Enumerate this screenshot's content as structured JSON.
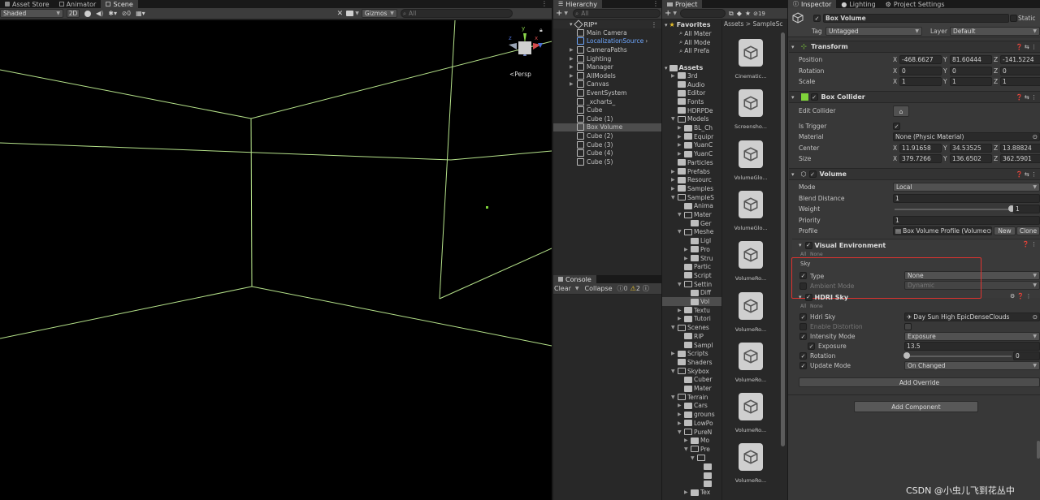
{
  "top_tabs": {
    "asset_store": "Asset Store",
    "animator": "Animator",
    "scene": "Scene",
    "hierarchy": "Hierarchy",
    "project": "Project",
    "inspector": "Inspector",
    "lighting": "Lighting",
    "project_settings": "Project Settings"
  },
  "scene_toolbar": {
    "shading": "Shaded",
    "mode_2d": "2D",
    "hidden_count": "0",
    "gizmos": "Gizmos",
    "search_placeholder": "All",
    "persp_label": "<Persp",
    "gizmo_y": "y",
    "gizmo_x": "x",
    "gizmo_z": "z"
  },
  "hierarchy": {
    "search_placeholder": "All",
    "root": "RIP*",
    "items": [
      {
        "label": "Main Camera",
        "selected": false,
        "arrow": false,
        "color": "#c4c4c4"
      },
      {
        "label": "LocalizationSource",
        "selected": false,
        "arrow": false,
        "color": "#6ea7ff"
      },
      {
        "label": "CameraPaths",
        "selected": false,
        "arrow": true,
        "color": "#c4c4c4"
      },
      {
        "label": "Lighting",
        "selected": false,
        "arrow": true,
        "color": "#c4c4c4"
      },
      {
        "label": "Manager",
        "selected": false,
        "arrow": true,
        "color": "#c4c4c4"
      },
      {
        "label": "AllModels",
        "selected": false,
        "arrow": true,
        "color": "#c4c4c4"
      },
      {
        "label": "Canvas",
        "selected": false,
        "arrow": true,
        "color": "#c4c4c4"
      },
      {
        "label": "EventSystem",
        "selected": false,
        "arrow": false,
        "color": "#c4c4c4"
      },
      {
        "label": "_xcharts_",
        "selected": false,
        "arrow": false,
        "color": "#c4c4c4"
      },
      {
        "label": "Cube",
        "selected": false,
        "arrow": false,
        "color": "#c4c4c4"
      },
      {
        "label": "Cube (1)",
        "selected": false,
        "arrow": false,
        "color": "#c4c4c4"
      },
      {
        "label": "Box Volume",
        "selected": true,
        "arrow": false,
        "color": "#c4c4c4"
      },
      {
        "label": "Cube (2)",
        "selected": false,
        "arrow": false,
        "color": "#c4c4c4"
      },
      {
        "label": "Cube (3)",
        "selected": false,
        "arrow": false,
        "color": "#c4c4c4"
      },
      {
        "label": "Cube (4)",
        "selected": false,
        "arrow": false,
        "color": "#c4c4c4"
      },
      {
        "label": "Cube (5)",
        "selected": false,
        "arrow": false,
        "color": "#c4c4c4"
      }
    ]
  },
  "console": {
    "tab": "Console",
    "clear": "Clear",
    "collapse": "Collapse",
    "info_count": "0",
    "warn_count": "2"
  },
  "project": {
    "hidden_count": "19",
    "breadcrumb": "Assets > SampleSc",
    "favorites": "Favorites",
    "fav_items": [
      "All Mater",
      "All Mode",
      "All Prefa"
    ],
    "assets_root": "Assets",
    "tree": [
      {
        "label": "3rd",
        "indent": 0,
        "arrow": "right"
      },
      {
        "label": "Audio",
        "indent": 0,
        "arrow": "none"
      },
      {
        "label": "Editor",
        "indent": 0,
        "arrow": "none"
      },
      {
        "label": "Fonts",
        "indent": 0,
        "arrow": "none"
      },
      {
        "label": "HDRPDe",
        "indent": 0,
        "arrow": "none"
      },
      {
        "label": "Models",
        "indent": 0,
        "arrow": "down"
      },
      {
        "label": "BL_Ch",
        "indent": 1,
        "arrow": "right"
      },
      {
        "label": "Equipr",
        "indent": 1,
        "arrow": "right"
      },
      {
        "label": "YuanC",
        "indent": 1,
        "arrow": "right"
      },
      {
        "label": "YuanC",
        "indent": 1,
        "arrow": "right"
      },
      {
        "label": "Particles",
        "indent": 0,
        "arrow": "none"
      },
      {
        "label": "Prefabs",
        "indent": 0,
        "arrow": "right"
      },
      {
        "label": "Resourc",
        "indent": 0,
        "arrow": "right"
      },
      {
        "label": "Samples",
        "indent": 0,
        "arrow": "right"
      },
      {
        "label": "SampleS",
        "indent": 0,
        "arrow": "down"
      },
      {
        "label": "Anima",
        "indent": 1,
        "arrow": "none"
      },
      {
        "label": "Mater",
        "indent": 1,
        "arrow": "down"
      },
      {
        "label": "Ger",
        "indent": 2,
        "arrow": "none"
      },
      {
        "label": "Meshe",
        "indent": 1,
        "arrow": "down"
      },
      {
        "label": "Ligl",
        "indent": 2,
        "arrow": "none"
      },
      {
        "label": "Pro",
        "indent": 2,
        "arrow": "right"
      },
      {
        "label": "Stru",
        "indent": 2,
        "arrow": "right"
      },
      {
        "label": "Partic",
        "indent": 1,
        "arrow": "none"
      },
      {
        "label": "Script",
        "indent": 1,
        "arrow": "none"
      },
      {
        "label": "Settin",
        "indent": 1,
        "arrow": "down"
      },
      {
        "label": "Diff",
        "indent": 2,
        "arrow": "none"
      },
      {
        "label": "Vol",
        "indent": 2,
        "arrow": "none",
        "selected": true
      },
      {
        "label": "Textu",
        "indent": 1,
        "arrow": "right"
      },
      {
        "label": "Tutori",
        "indent": 1,
        "arrow": "right"
      },
      {
        "label": "Scenes",
        "indent": 0,
        "arrow": "down"
      },
      {
        "label": "RIP",
        "indent": 1,
        "arrow": "none"
      },
      {
        "label": "Sampl",
        "indent": 1,
        "arrow": "none"
      },
      {
        "label": "Scripts",
        "indent": 0,
        "arrow": "right"
      },
      {
        "label": "Shaders",
        "indent": 0,
        "arrow": "none"
      },
      {
        "label": "Skybox",
        "indent": 0,
        "arrow": "down"
      },
      {
        "label": "Cuber",
        "indent": 1,
        "arrow": "none"
      },
      {
        "label": "Mater",
        "indent": 1,
        "arrow": "none"
      },
      {
        "label": "Terrain",
        "indent": 0,
        "arrow": "down"
      },
      {
        "label": "Cars",
        "indent": 1,
        "arrow": "right"
      },
      {
        "label": "grouns",
        "indent": 1,
        "arrow": "right"
      },
      {
        "label": "LowPo",
        "indent": 1,
        "arrow": "right"
      },
      {
        "label": "PureN",
        "indent": 1,
        "arrow": "down"
      },
      {
        "label": "Mo",
        "indent": 2,
        "arrow": "right"
      },
      {
        "label": "Pre",
        "indent": 2,
        "arrow": "down"
      },
      {
        "label": "",
        "indent": 3,
        "arrow": "down"
      },
      {
        "label": "",
        "indent": 4,
        "arrow": "none"
      },
      {
        "label": "",
        "indent": 4,
        "arrow": "none"
      },
      {
        "label": "",
        "indent": 4,
        "arrow": "none"
      },
      {
        "label": "Tex",
        "indent": 2,
        "arrow": "right"
      }
    ],
    "assets": [
      "Cinematic...",
      "Screensho...",
      "VolumeGlo...",
      "VolumeGlo...",
      "VolumeRo...",
      "VolumeRo...",
      "VolumeRo...",
      "VolumeRo...",
      "VolumeRo..."
    ]
  },
  "inspector": {
    "object_name": "Box Volume",
    "static_label": "Static",
    "tag_label": "Tag",
    "tag_value": "Untagged",
    "layer_label": "Layer",
    "layer_value": "Default",
    "transform": {
      "title": "Transform",
      "position_label": "Position",
      "rotation_label": "Rotation",
      "scale_label": "Scale",
      "position": [
        "-468.6627",
        "81.60444",
        "-141.5224"
      ],
      "rotation": [
        "0",
        "0",
        "0"
      ],
      "scale": [
        "1",
        "1",
        "1"
      ]
    },
    "box_collider": {
      "title": "Box Collider",
      "edit_collider": "Edit Collider",
      "is_trigger": "Is Trigger",
      "material_label": "Material",
      "material_value": "None (Physic Material)",
      "center_label": "Center",
      "center": [
        "11.91658",
        "34.53525",
        "13.88824"
      ],
      "size_label": "Size",
      "size": [
        "379.7266",
        "136.6502",
        "362.5901"
      ]
    },
    "volume": {
      "title": "Volume",
      "mode_label": "Mode",
      "mode_value": "Local",
      "blend_label": "Blend Distance",
      "blend_value": "1",
      "weight_label": "Weight",
      "weight_value": "1",
      "weight_fraction": 1.0,
      "priority_label": "Priority",
      "priority_value": "1",
      "profile_label": "Profile",
      "profile_value": "Box Volume Profile (Volume",
      "new_btn": "New",
      "clone_btn": "Clone"
    },
    "visual_env": {
      "title": "Visual Environment",
      "all": "All",
      "none": "None",
      "sky_section": "Sky",
      "type_label": "Type",
      "type_value": "None",
      "ambient_label": "Ambient Mode",
      "ambient_value": "Dynamic"
    },
    "hdri_sky": {
      "title": "HDRI Sky",
      "all": "All",
      "none": "None",
      "hdri_label": "Hdri Sky",
      "hdri_value": "Day Sun High EpicDenseClouds",
      "distortion_label": "Enable Distortion",
      "intensity_label": "Intensity Mode",
      "intensity_value": "Exposure",
      "exposure_label": "Exposure",
      "exposure_value": "13.5",
      "rotation_label": "Rotation",
      "rotation_value": "0",
      "rotation_fraction": 0.0,
      "update_label": "Update Mode",
      "update_value": "On Changed"
    },
    "add_override": "Add Override",
    "add_component": "Add Component"
  },
  "watermark": "CSDN @小虫儿飞到花丛中",
  "colors": {
    "highlight_box": "#e0332f",
    "selection": "#4d4d4d",
    "scene_lines": "#b5e28a"
  }
}
